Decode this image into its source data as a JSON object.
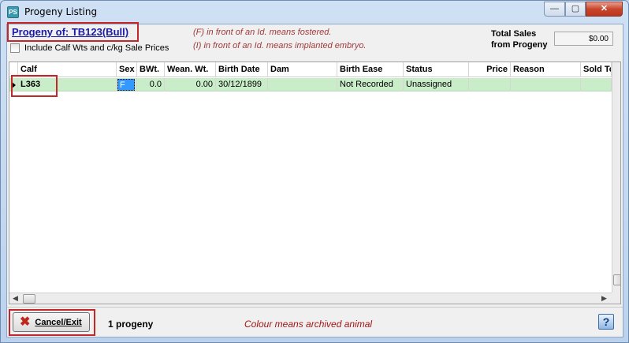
{
  "window": {
    "title": "Progeny Listing",
    "app_icon": "PS",
    "controls": {
      "minimize": "—",
      "maximize": "▢",
      "close": "✕"
    }
  },
  "header": {
    "progeny_of": "Progeny of: TB123(Bull)",
    "note_fostered": "(F) in front of an Id. means fostered.",
    "note_embryo": "(I) in front of an Id. means implanted embryo.",
    "include_label": "Include Calf Wts and c/kg Sale Prices",
    "include_checked": false,
    "total_label_line1": "Total Sales",
    "total_label_line2": "from Progeny",
    "total_value": "$0.00"
  },
  "grid": {
    "columns": [
      "Calf",
      "Sex",
      "BWt.",
      "Wean. Wt.",
      "Birth Date",
      "Dam",
      "Birth Ease",
      "Status",
      "Price",
      "Reason",
      "Sold To"
    ],
    "rows": [
      {
        "calf": "L363",
        "sex": "F",
        "bwt": "0.0",
        "wean_wt": "0.00",
        "birth_date": "30/12/1899",
        "dam": "",
        "birth_ease": "Not Recorded",
        "status": "Unassigned",
        "price": "",
        "reason": "",
        "sold_to": ""
      }
    ],
    "row_color": "#c9ecc9"
  },
  "footer": {
    "cancel_label": "Cancel/Exit",
    "count_text": "1 progeny",
    "colour_note": "Colour means archived animal",
    "help_label": "?"
  },
  "colors": {
    "highlight_box": "#c2282a",
    "link_blue": "#1a1aa6",
    "note_red": "#a33a3a"
  }
}
